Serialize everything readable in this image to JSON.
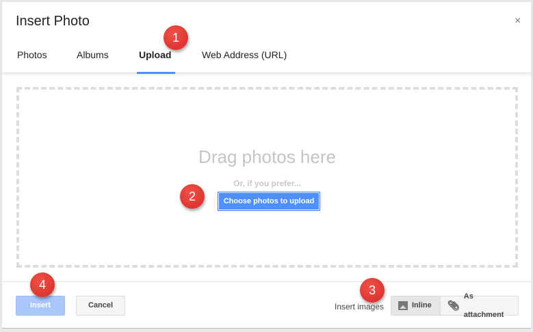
{
  "dialog": {
    "title": "Insert Photo",
    "close": "×"
  },
  "tabs": [
    {
      "label": "Photos"
    },
    {
      "label": "Albums"
    },
    {
      "label": "Upload",
      "active": true
    },
    {
      "label": "Web Address (URL)"
    }
  ],
  "dropzone": {
    "heading": "Drag photos here",
    "subtext": "Or, if you prefer...",
    "choose_button": "Choose photos to upload"
  },
  "footer": {
    "insert": "Insert",
    "cancel": "Cancel",
    "insert_images_label": "Insert images",
    "inline": "Inline",
    "as_attachment": "As attachment"
  },
  "badges": [
    "1",
    "2",
    "3",
    "4"
  ],
  "colors": {
    "accent": "#4d90fe",
    "badge": "#e0322c"
  }
}
